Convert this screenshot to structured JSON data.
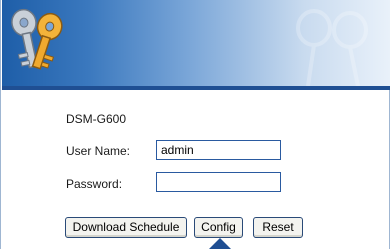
{
  "banner": {
    "logo_icon": "keys-icon",
    "watermark_icon": "keys-icon"
  },
  "device": {
    "model": "DSM-G600"
  },
  "login": {
    "username_label": "User Name:",
    "username_value": "admin",
    "password_label": "Password:",
    "password_value": ""
  },
  "buttons": {
    "download_schedule": "Download Schedule",
    "config": "Config",
    "reset": "Reset"
  },
  "colors": {
    "banner_dark": "#1e5ea8",
    "banner_light": "#e9f1fa",
    "field_border": "#2a5aa0"
  }
}
